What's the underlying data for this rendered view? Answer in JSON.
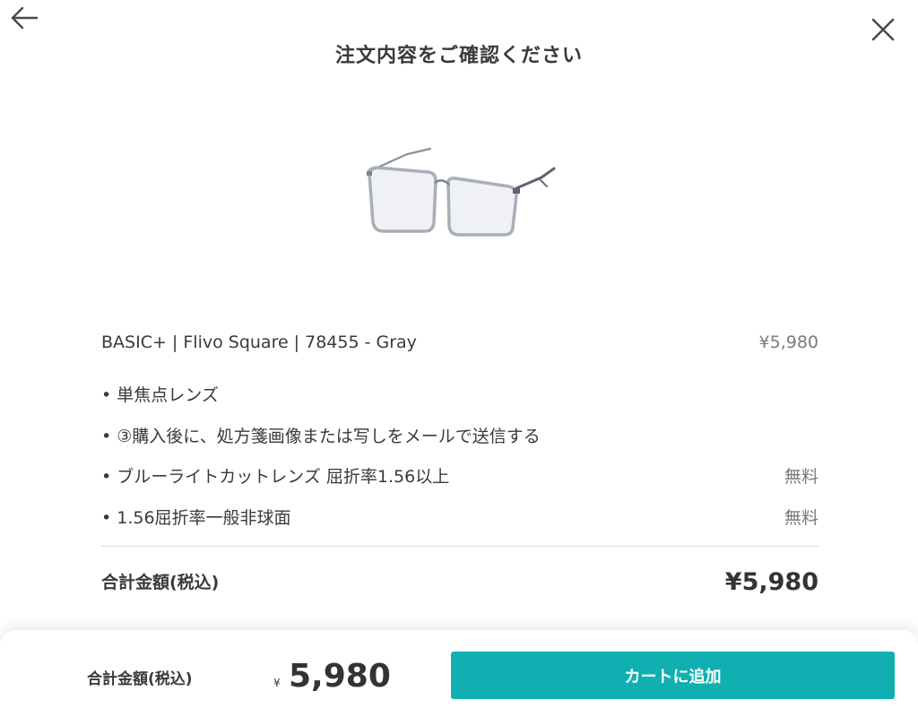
{
  "header": {
    "title": "注文内容をご確認ください",
    "back_icon": "arrow-left-icon",
    "close_icon": "close-icon"
  },
  "product": {
    "image": "eyeglasses-gray-square-frame",
    "name": "BASIC+ | Flivo Square | 78455 - Gray",
    "price": "¥5,980"
  },
  "options": [
    {
      "label": "• 単焦点レンズ",
      "price": ""
    },
    {
      "label": "• ③購入後に、処方箋画像または写しをメールで送信する",
      "price": ""
    },
    {
      "label": "• ブルーライトカットレンズ 屈折率1.56以上",
      "price": "無料"
    },
    {
      "label": "• 1.56屈折率一般非球面",
      "price": "無料"
    }
  ],
  "summary": {
    "total_label": "合計金額(税込)",
    "total_amount": "¥5,980"
  },
  "footer": {
    "total_label": "合計金額(税込)",
    "currency": "¥",
    "amount": "5,980",
    "cart_button_label": "カートに追加"
  },
  "colors": {
    "accent": "#10b0b2",
    "text": "#3a3a3a",
    "muted": "#7a7a7a"
  }
}
